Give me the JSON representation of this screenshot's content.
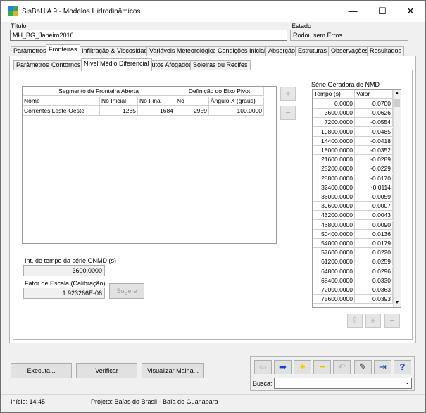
{
  "window": {
    "title": "SisBaHiA 9 - Modelos Hidrodinâmicos",
    "minimize": "—",
    "maximize": "☐",
    "close": "✕"
  },
  "header": {
    "titulo_label": "Título",
    "titulo_value": "MH_BG_Janeiro2016",
    "estado_label": "Estado",
    "estado_value": "Rodou sem Erros"
  },
  "main_tabs": [
    {
      "label": "Parâmetros"
    },
    {
      "label": "Fronteiras"
    },
    {
      "label": "Infiltração & Viscosidade"
    },
    {
      "label": "Variáveis Meteorológicas"
    },
    {
      "label": "Condições Iniciais"
    },
    {
      "label": "Absorção"
    },
    {
      "label": "Estruturas"
    },
    {
      "label": "Observações"
    },
    {
      "label": "Resultados"
    }
  ],
  "sub_tabs": [
    {
      "label": "Parâmetros"
    },
    {
      "label": "Contornos"
    },
    {
      "label": "Nível Médio Diferencial"
    },
    {
      "label": "Dutos Afogados"
    },
    {
      "label": "Soleiras ou Recifes"
    }
  ],
  "boundary_table": {
    "group1": "Segmento de Fronteira Aberta",
    "group2": "Definição do Eixo Pivot",
    "columns": [
      "Nome",
      "Nó Inicial",
      "Nó Final",
      "Nó",
      "Ângulo X (graus)"
    ],
    "rows": [
      {
        "nome": "Correntes Leste-Oeste",
        "no_inicial": "1285",
        "no_final": "1684",
        "no": "2959",
        "angulo": "100.0000"
      }
    ]
  },
  "side_buttons": {
    "add": "+",
    "remove": "−"
  },
  "gnmd": {
    "interval_label": "Int. de tempo da série GNMD (s)",
    "interval_value": "3600.0000",
    "scale_label": "Fator de Escala (Calibração)",
    "scale_value": "1.923266E-06",
    "sugere_label": "Sugere"
  },
  "series": {
    "title": "Série Geradora de NMD",
    "col_time": "Tempo (s)",
    "col_value": "Valor",
    "rows": [
      [
        "0.0000",
        "-0.0700"
      ],
      [
        "3600.0000",
        "-0.0626"
      ],
      [
        "7200.0000",
        "-0.0554"
      ],
      [
        "10800.0000",
        "-0.0485"
      ],
      [
        "14400.0000",
        "-0.0418"
      ],
      [
        "18000.0000",
        "-0.0352"
      ],
      [
        "21600.0000",
        "-0.0289"
      ],
      [
        "25200.0000",
        "-0.0229"
      ],
      [
        "28800.0000",
        "-0.0170"
      ],
      [
        "32400.0000",
        "-0.0114"
      ],
      [
        "36000.0000",
        "-0.0059"
      ],
      [
        "39600.0000",
        "-0.0007"
      ],
      [
        "43200.0000",
        "0.0043"
      ],
      [
        "46800.0000",
        "0.0090"
      ],
      [
        "50400.0000",
        "0.0136"
      ],
      [
        "54000.0000",
        "0.0179"
      ],
      [
        "57600.0000",
        "0.0220"
      ],
      [
        "61200.0000",
        "0.0259"
      ],
      [
        "64800.0000",
        "0.0296"
      ],
      [
        "68400.0000",
        "0.0330"
      ],
      [
        "72000.0000",
        "0.0363"
      ],
      [
        "75600.0000",
        "0.0393"
      ]
    ],
    "scroll_up": "▲",
    "scroll_down": "▼"
  },
  "series_buttons": {
    "import": "⇪",
    "add": "+",
    "remove": "−"
  },
  "actions": {
    "executa": "Executa...",
    "verificar": "Verificar",
    "visualizar": "Visualizar Malha..."
  },
  "toolbar": {
    "back": "⇦",
    "forward": "➡",
    "add": "+",
    "remove": "−",
    "undo": "↶",
    "edit": "✎",
    "exit": "⇥",
    "help": "?"
  },
  "busca": {
    "label": "Busca:",
    "value": "",
    "dropdown": "⌄"
  },
  "status": {
    "inicio": "Início: 14:45",
    "projeto": "Projeto: Baías do Brasil - Baía de Guanabara"
  },
  "colors": {
    "accent_blue": "#1a3fcf",
    "accent_yellow": "#e8c400",
    "help_blue": "#1a3fcf"
  }
}
